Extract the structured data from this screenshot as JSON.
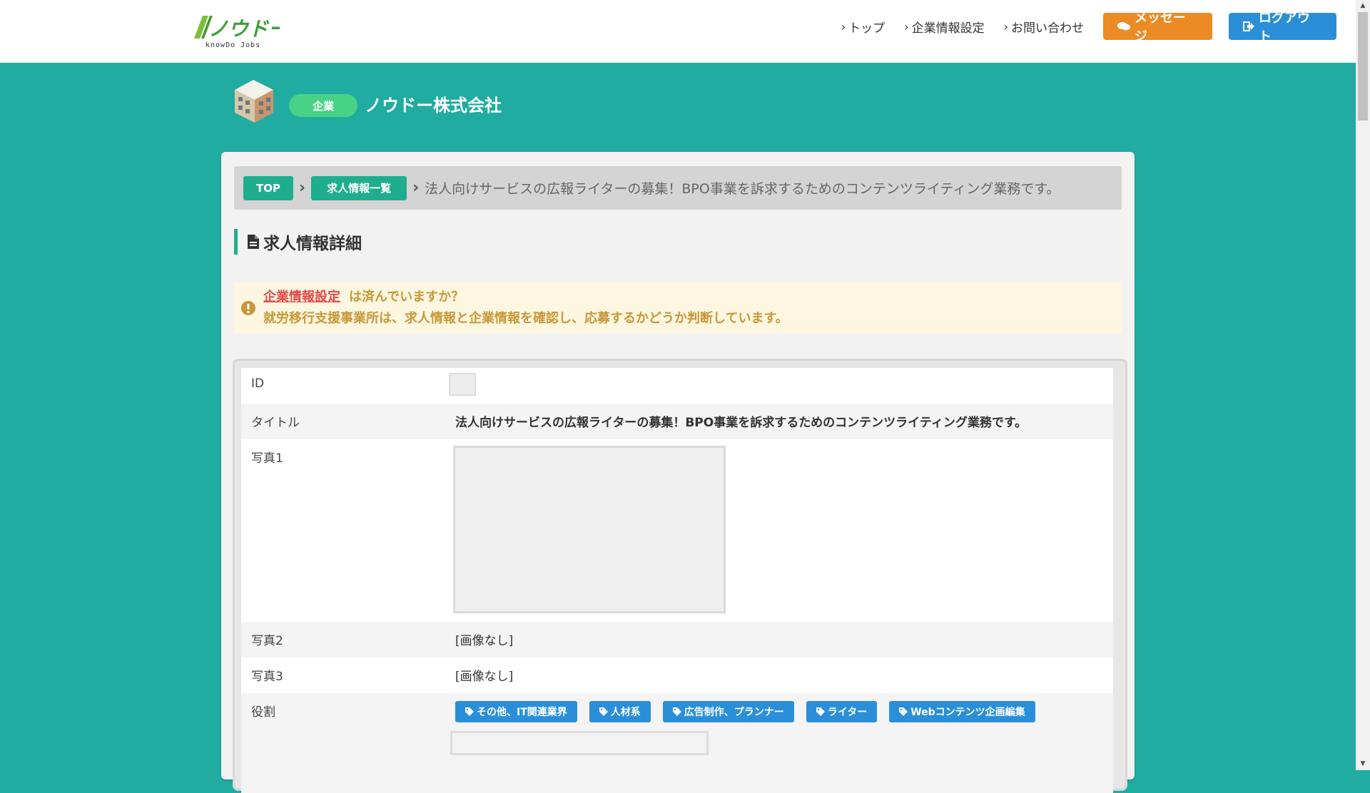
{
  "header": {
    "logo_text": "ノウドー",
    "logo_sub": "knowDo Jobs",
    "nav": [
      {
        "label": "トップ"
      },
      {
        "label": "企業情報設定"
      },
      {
        "label": "お問い合わせ"
      }
    ],
    "message_button": "メッセージ",
    "logout_button": "ログアウト",
    "colors": {
      "message": "#ec8a24",
      "logout": "#2a8fd8",
      "brand": "#20aca0"
    }
  },
  "company": {
    "badge": "企業",
    "name": "ノウドー株式会社"
  },
  "breadcrumb": {
    "top": "TOP",
    "list": "求人情報一覧",
    "current": "法人向けサービスの広報ライターの募集！BPO事業を訴求するためのコンテンツライティング業務です。"
  },
  "section_title": "求人情報詳細",
  "alert": {
    "link": "企業情報設定",
    "line1": "は済んでいますか？",
    "line2": "就労移行支援事業所は、求人情報と企業情報を確認し、応募するかどうか判断しています。"
  },
  "table": {
    "id_label": "ID",
    "title_label": "タイトル",
    "title_value": "法人向けサービスの広報ライターの募集！BPO事業を訴求するためのコンテンツライティング業務です。",
    "photo1_label": "写真1",
    "photo2_label": "写真2",
    "photo2_value": "[画像なし]",
    "photo3_label": "写真3",
    "photo3_value": "[画像なし]",
    "role_label": "役割",
    "role_tags": [
      "その他、IT関連業界",
      "人材系",
      "広告制作、プランナー",
      "ライター",
      "Webコンテンツ企画編集"
    ]
  }
}
